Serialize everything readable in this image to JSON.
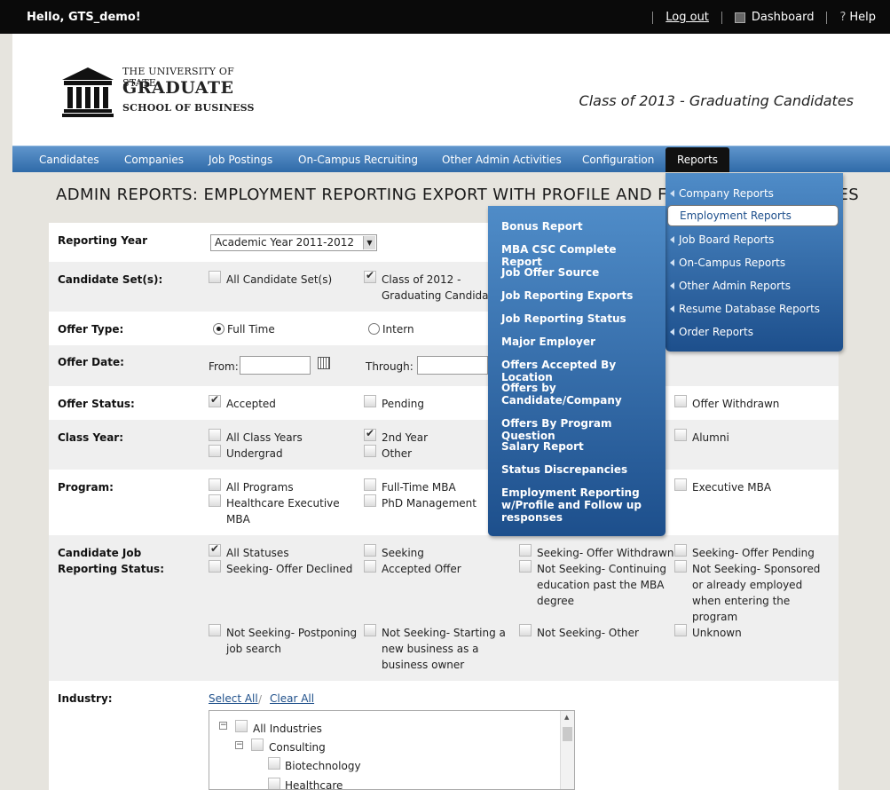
{
  "topbar": {
    "greeting": "Hello, GTS_demo!",
    "logout": "Log out",
    "dashboard": "Dashboard",
    "help": "Help"
  },
  "logo": {
    "line1": "THE UNIVERSITY OF STATE",
    "line2": "GRADUATE",
    "line3": "SCHOOL OF BUSINESS"
  },
  "class_title": "Class of 2013 - Graduating Candidates",
  "nav": [
    "Candidates",
    "Companies",
    "Job Postings",
    "On-Campus Recruiting",
    "Other Admin Activities",
    "Configuration",
    "Reports"
  ],
  "page_title": "ADMIN REPORTS: EMPLOYMENT REPORTING EXPORT WITH PROFILE AND FOLLOW UP RESPONSES",
  "form": {
    "reporting_year": {
      "label": "Reporting Year",
      "value": "Academic Year 2011-2012"
    },
    "candidate_sets": {
      "label": "Candidate Set(s):",
      "all": "All Candidate Set(s)",
      "class_line1": "Class of 2012 -",
      "class_line2": "Graduating Candidat"
    },
    "offer_type": {
      "label": "Offer Type:",
      "full_time": "Full Time",
      "intern": "Intern"
    },
    "offer_date": {
      "label": "Offer Date:",
      "from": "From:",
      "through": "Through:"
    },
    "offer_status": {
      "label": "Offer Status:",
      "accepted": "Accepted",
      "pending": "Pending",
      "withdrawn": "Offer Withdrawn"
    },
    "class_year": {
      "label": "Class Year:",
      "all": "All Class Years",
      "undergrad": "Undergrad",
      "second": "2nd Year",
      "other": "Other",
      "alumni": "Alumni"
    },
    "program": {
      "label": "Program:",
      "all": "All Programs",
      "health1": "Healthcare Executive",
      "health2": "MBA",
      "fulltime": "Full-Time MBA",
      "phd": "PhD Management",
      "exec": "Executive MBA"
    },
    "status": {
      "label1": "Candidate Job",
      "label2": "Reporting Status:",
      "all": "All Statuses",
      "declined": "Seeking- Offer Declined",
      "seeking": "Seeking",
      "accepted": "Accepted Offer",
      "withdrawn": "Seeking- Offer Withdrawn",
      "cont1": "Not Seeking- Continuing",
      "cont2": "education past the MBA",
      "cont3": "degree",
      "pending": "Seeking- Offer Pending",
      "spon1": "Not Seeking- Sponsored",
      "spon2": "or already employed",
      "spon3": "when entering the",
      "spon4": "program",
      "post1": "Not Seeking- Postponing",
      "post2": "job search",
      "start1": "Not Seeking- Starting a",
      "start2": "new business as a",
      "start3": "business owner",
      "nsother": "Not Seeking- Other",
      "unknown": "Unknown"
    },
    "industry": {
      "label": "Industry:",
      "select_all": "Select All",
      "clear_all": "Clear All",
      "tree": [
        "All Industries",
        "Consulting",
        "Biotechnology",
        "Healthcare"
      ]
    }
  },
  "reports_menu": [
    "Company Reports",
    "Employment Reports",
    "Job Board Reports",
    "On-Campus Reports",
    "Other Admin Reports",
    "Resume Database Reports",
    "Order Reports"
  ],
  "employment_menu": {
    "bonus": "Bonus Report",
    "mba_csc": "MBA CSC Complete Report",
    "offer_source": "Job Offer Source",
    "exports": "Job Reporting Exports",
    "status": "Job Reporting Status",
    "major": "Major Employer",
    "by_location": "Offers Accepted By Location",
    "by_cand1": "Offers by",
    "by_cand2": "Candidate/Company",
    "by_program": "Offers By Program Question",
    "salary": "Salary Report",
    "discrep": "Status Discrepancies",
    "er1": "Employment Reporting",
    "er2": "w/Profile and Follow up",
    "er3": "responses"
  }
}
